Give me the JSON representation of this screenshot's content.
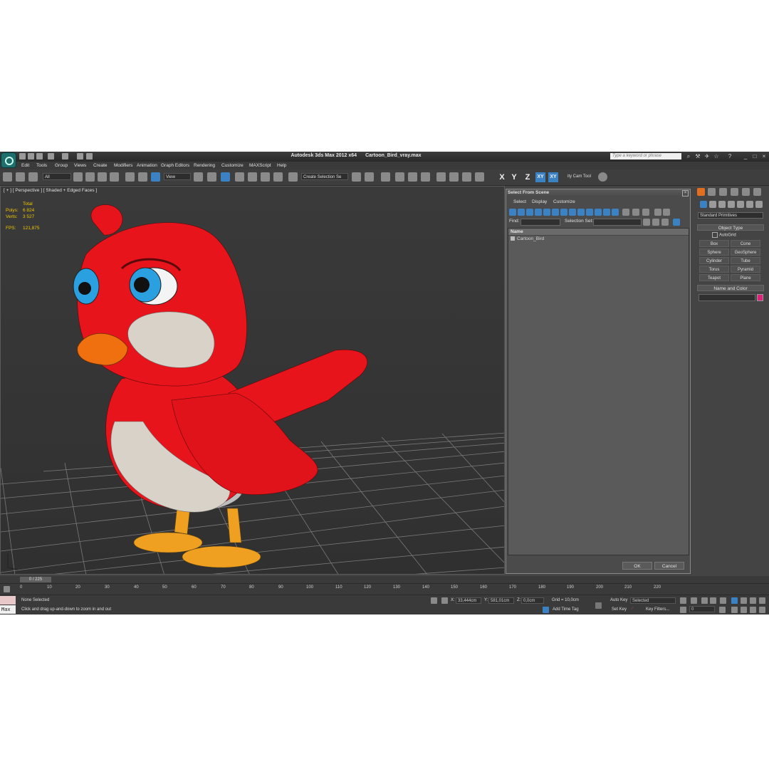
{
  "app": {
    "title": "Autodesk 3ds Max  2012 x64",
    "file": "Cartoon_Bird_vray.max",
    "search_placeholder": "Type a keyword or phrase"
  },
  "menu": [
    "Edit",
    "Tools",
    "Group",
    "Views",
    "Create",
    "Modifiers",
    "Animation",
    "Graph Editors",
    "Rendering",
    "Customize",
    "MAXScript",
    "Help"
  ],
  "toolbar": {
    "filter_value": "All",
    "coord_value": "View",
    "selection_set": "Create Selection Se",
    "axes": [
      "X",
      "Y",
      "Z",
      "XY",
      "XY"
    ],
    "utility_label": "ity Cam Tool"
  },
  "viewport": {
    "label": "[ + ] [ Perspective ] [ Shaded + Edged Faces ]",
    "stats": {
      "total_label": "Total",
      "polys_label": "Polys:",
      "polys_value": "6 824",
      "verts_label": "Verts:",
      "verts_value": "3 527",
      "fps_label": "FPS:",
      "fps_value": "121,875"
    },
    "colors": {
      "body": "#e8141c",
      "belly": "#d8d2c8",
      "beak": "#f07010",
      "legs": "#f0a020",
      "eye": "#2aa0e0"
    }
  },
  "dialog": {
    "title": "Select From Scene",
    "menu": [
      "Select",
      "Display",
      "Customize"
    ],
    "find_label": "Find:",
    "selection_set_label": "Selection Set:",
    "column_name": "Name",
    "items": [
      "Cartoon_Bird"
    ],
    "ok": "OK",
    "cancel": "Cancel"
  },
  "command_panel": {
    "category": "Standard Primitives",
    "object_type_title": "Object Type",
    "autogrid": "AutoGrid",
    "buttons": [
      "Box",
      "Cone",
      "Sphere",
      "GeoSphere",
      "Cylinder",
      "Tube",
      "Torus",
      "Pyramid",
      "Teapot",
      "Plane"
    ],
    "name_color_title": "Name and Color",
    "swatch_color": "#e0207a"
  },
  "timeline": {
    "frame_label": "0 / 225",
    "ticks": [
      "0",
      "10",
      "20",
      "30",
      "40",
      "50",
      "60",
      "70",
      "80",
      "90",
      "100",
      "110",
      "120",
      "130",
      "140",
      "150",
      "160",
      "170",
      "180",
      "190",
      "200",
      "210",
      "220"
    ]
  },
  "status": {
    "selection": "None Selected",
    "prompt": "Click and drag up-and-down to zoom in and out",
    "max_label": "Max",
    "x_label": "X:",
    "x_value": "33,444cm",
    "y_label": "Y:",
    "y_value": "581,01cm",
    "z_label": "Z:",
    "z_value": "0,0cm",
    "grid": "Grid = 10,0cm",
    "add_time_tag": "Add Time Tag",
    "auto_key": "Auto Key",
    "set_key": "Set Key",
    "selected": "Selected",
    "key_filters": "Key Filters...",
    "frame_value": "0"
  }
}
